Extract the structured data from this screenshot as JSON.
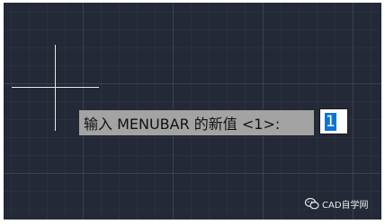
{
  "command_prompt": {
    "label": "输入 MENUBAR 的新值 <1>:",
    "value": "1"
  },
  "watermark": {
    "text": "CAD自学网",
    "icon": "wechat-icon"
  },
  "colors": {
    "canvas": "#232936",
    "crosshair": "#e6e8ec",
    "prompt_background": "#a3a3a3",
    "selection": "#0c74d6"
  }
}
